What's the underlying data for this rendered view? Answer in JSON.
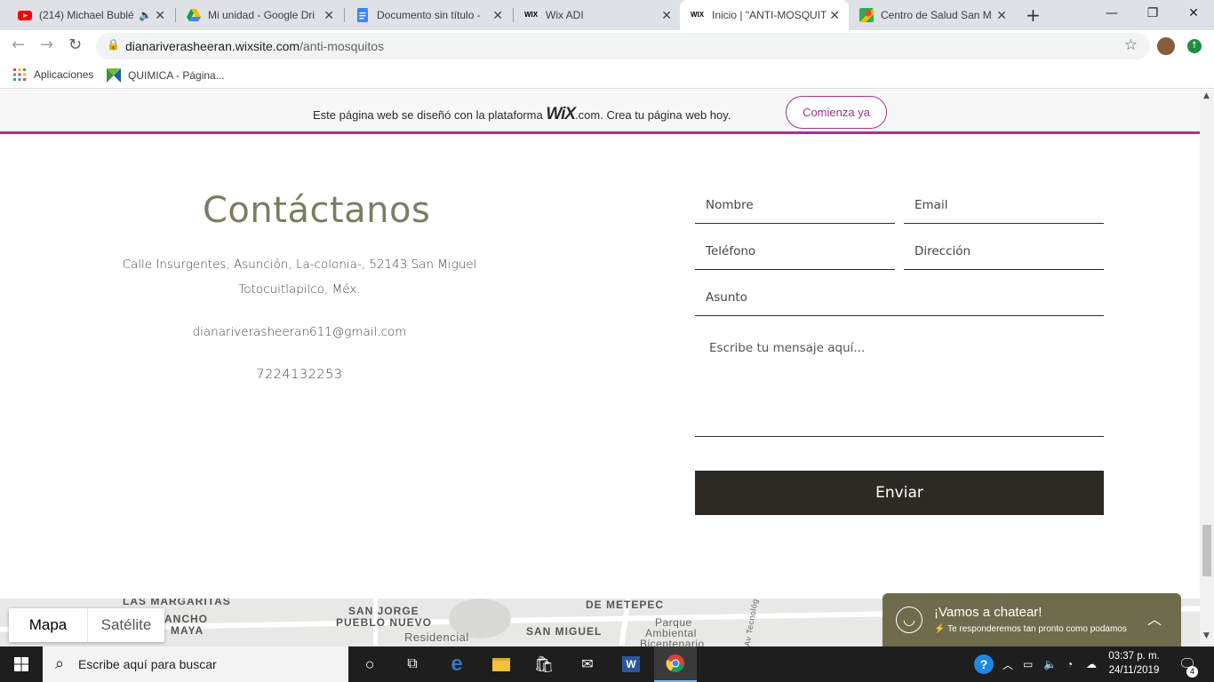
{
  "browser": {
    "tabs": [
      {
        "title": "(214) Michael Bublé",
        "icon": "youtube-icon"
      },
      {
        "title": "Mi unidad - Google Dri",
        "icon": "drive-icon"
      },
      {
        "title": "Documento sin título - ",
        "icon": "docs-icon"
      },
      {
        "title": "Wix ADI",
        "icon": "wix-icon"
      },
      {
        "title": "Inicio | \"ANTI-MOSQUIT",
        "icon": "wix-icon"
      },
      {
        "title": "Centro de Salud San M",
        "icon": "maps-icon"
      }
    ],
    "url_host": "dianariverasheeran.wixsite.com",
    "url_path": "/anti-mosquitos",
    "bookmarks": [
      {
        "label": "Aplicaciones"
      },
      {
        "label": "QUIMICA - Página..."
      }
    ]
  },
  "wix_banner": {
    "text_before": "Este página web se diseñó con la plataforma",
    "logo": "WiX",
    "text_after": ".com. Crea tu página web hoy.",
    "cta_label": "Comienza ya",
    "accent": "#a0348b"
  },
  "contact": {
    "title": "Contáctanos",
    "address_line1": "Calle Insurgentes, Asunción, La-colonia-, 52143 San Miguel",
    "address_line2": "Totocuitlapilco, Méx.",
    "email": "dianariverasheeran611@gmail.com",
    "phone": "7224132253"
  },
  "form": {
    "name_placeholder": "Nombre",
    "email_placeholder": "Email",
    "phone_placeholder": "Teléfono",
    "address_placeholder": "Dirección",
    "subject_placeholder": "Asunto",
    "message_placeholder": "Escribe tu mensaje aquí...",
    "submit_label": "Enviar"
  },
  "map": {
    "type_map": "Mapa",
    "type_satellite": "Satélite",
    "labels": [
      "LAS MARGARITAS",
      "ANCHO",
      "MAYA",
      "SAN JORGE",
      "PUEBLO NUEVO",
      "Residencial",
      "DE METEPEC",
      "Parque",
      "Ambiental",
      "Bicentenario",
      "SAN MIGUEL",
      "Av Tecnológ"
    ]
  },
  "chat": {
    "title": "¡Vamos a chatear!",
    "subtitle": "Te responderemos tan pronto como podamos",
    "color": "#6f6c4e"
  },
  "taskbar": {
    "search_placeholder": "Escribe aquí para buscar",
    "time": "03:37 p. m.",
    "date": "24/11/2019",
    "notifications": "4"
  }
}
